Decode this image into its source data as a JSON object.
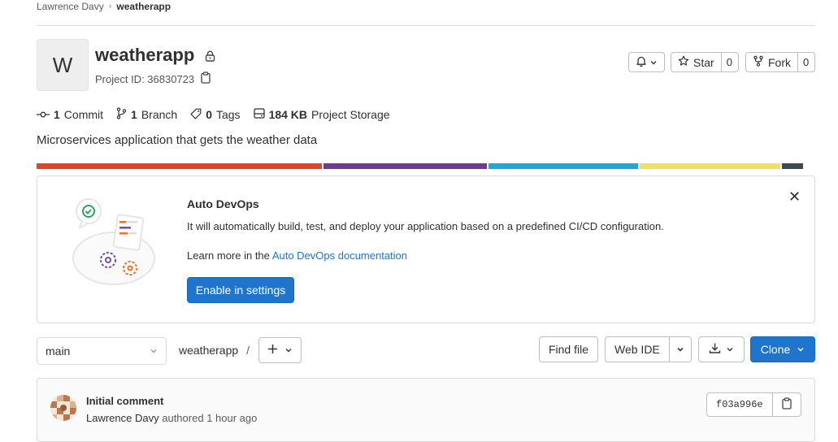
{
  "breadcrumb": {
    "owner": "Lawrence Davy",
    "project": "weatherapp"
  },
  "project": {
    "avatar_letter": "W",
    "name": "weatherapp",
    "id_text": "Project ID: 36830723",
    "description": "Microservices application that gets the weather data"
  },
  "actions": {
    "star_label": "Star",
    "star_count": "0",
    "fork_label": "Fork",
    "fork_count": "0"
  },
  "stats": {
    "commits_num": "1",
    "commits_label": "Commit",
    "branches_num": "1",
    "branches_label": "Branch",
    "tags_num": "0",
    "tags_label": "Tags",
    "storage_num": "184 KB",
    "storage_label": "Project Storage"
  },
  "languages": [
    {
      "percent": 37.5,
      "color": "#e24329"
    },
    {
      "percent": 21.5,
      "color": "#6e3b8f"
    },
    {
      "percent": 19.7,
      "color": "#1aaad6"
    },
    {
      "percent": 18.5,
      "color": "#f1e05a"
    },
    {
      "percent": 2.8,
      "color": "#3b4c50"
    }
  ],
  "devops": {
    "title": "Auto DevOps",
    "text": "It will automatically build, test, and deploy your application based on a predefined CI/CD configuration.",
    "learn_prefix": "Learn more in the",
    "learn_link": "Auto DevOps documentation",
    "enable_label": "Enable in settings"
  },
  "toolbar": {
    "branch": "main",
    "path": "weatherapp",
    "path_sep": "/",
    "find_file": "Find file",
    "web_ide": "Web IDE",
    "clone": "Clone"
  },
  "commit": {
    "title": "Initial comment",
    "author": "Lawrence Davy",
    "authored": "authored",
    "time": "1 hour ago",
    "sha": "f03a996e"
  },
  "colors": {
    "accent": "#1f75cb",
    "text": "#303030",
    "border": "#dbdbdb"
  },
  "icons": [
    "chevron-right-icon",
    "lock-icon",
    "clipboard-icon",
    "bell-icon",
    "chevron-down-icon",
    "star-icon",
    "fork-icon",
    "commit-icon",
    "branch-icon",
    "tag-icon",
    "storage-icon",
    "close-icon",
    "plus-icon",
    "download-icon"
  ]
}
